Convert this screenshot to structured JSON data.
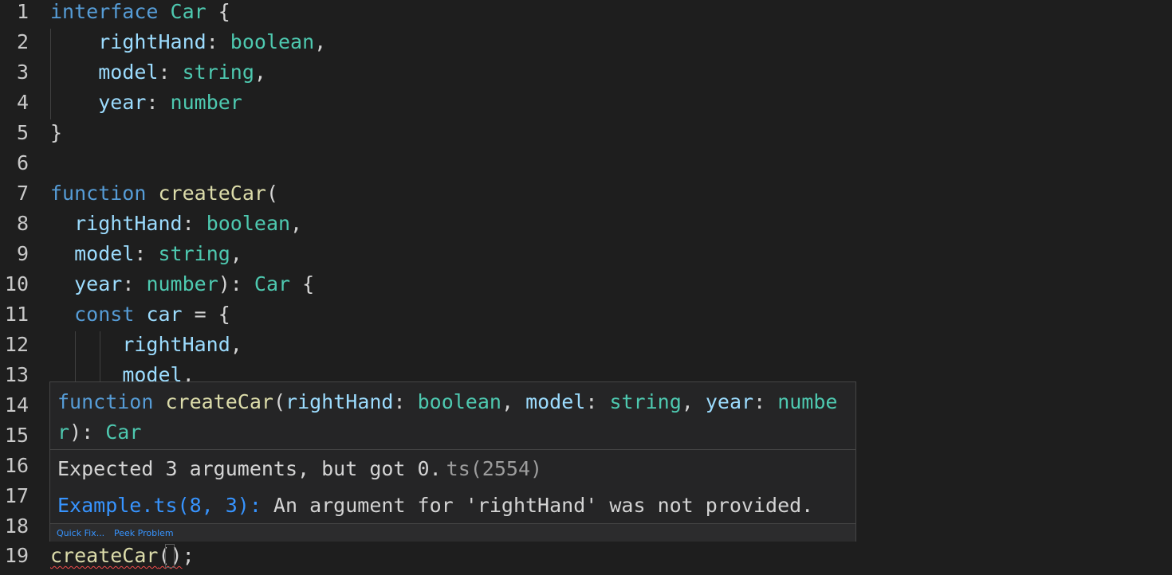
{
  "editor": {
    "lines": [
      {
        "num": "1",
        "tokens": [
          [
            "kw",
            "interface"
          ],
          [
            "pu",
            " "
          ],
          [
            "ty",
            "Car"
          ],
          [
            "pu",
            " {"
          ]
        ]
      },
      {
        "num": "2",
        "tokens": [
          [
            "pu",
            "    "
          ],
          [
            "pr",
            "rightHand"
          ],
          [
            "pu",
            ": "
          ],
          [
            "ty",
            "boolean"
          ],
          [
            "pu",
            ","
          ]
        ]
      },
      {
        "num": "3",
        "tokens": [
          [
            "pu",
            "    "
          ],
          [
            "pr",
            "model"
          ],
          [
            "pu",
            ": "
          ],
          [
            "ty",
            "string"
          ],
          [
            "pu",
            ","
          ]
        ]
      },
      {
        "num": "4",
        "tokens": [
          [
            "pu",
            "    "
          ],
          [
            "pr",
            "year"
          ],
          [
            "pu",
            ": "
          ],
          [
            "ty",
            "number"
          ]
        ]
      },
      {
        "num": "5",
        "tokens": [
          [
            "pu",
            "}"
          ]
        ]
      },
      {
        "num": "6",
        "tokens": []
      },
      {
        "num": "7",
        "tokens": [
          [
            "kw",
            "function"
          ],
          [
            "pu",
            " "
          ],
          [
            "fn",
            "createCar"
          ],
          [
            "pu",
            "("
          ]
        ]
      },
      {
        "num": "8",
        "tokens": [
          [
            "pu",
            "  "
          ],
          [
            "pr",
            "rightHand"
          ],
          [
            "pu",
            ": "
          ],
          [
            "ty",
            "boolean"
          ],
          [
            "pu",
            ","
          ]
        ]
      },
      {
        "num": "9",
        "tokens": [
          [
            "pu",
            "  "
          ],
          [
            "pr",
            "model"
          ],
          [
            "pu",
            ": "
          ],
          [
            "ty",
            "string"
          ],
          [
            "pu",
            ","
          ]
        ]
      },
      {
        "num": "10",
        "tokens": [
          [
            "pu",
            "  "
          ],
          [
            "pr",
            "year"
          ],
          [
            "pu",
            ": "
          ],
          [
            "ty",
            "number"
          ],
          [
            "pu",
            "): "
          ],
          [
            "ty",
            "Car"
          ],
          [
            "pu",
            " {"
          ]
        ]
      },
      {
        "num": "11",
        "tokens": [
          [
            "pu",
            "  "
          ],
          [
            "kw",
            "const"
          ],
          [
            "pu",
            " "
          ],
          [
            "pr",
            "car"
          ],
          [
            "pu",
            " = {"
          ]
        ]
      },
      {
        "num": "12",
        "tokens": [
          [
            "pu",
            "      "
          ],
          [
            "pr",
            "rightHand"
          ],
          [
            "pu",
            ","
          ]
        ]
      },
      {
        "num": "13",
        "tokens": [
          [
            "pu",
            "      "
          ],
          [
            "pr",
            "model"
          ],
          [
            "pu",
            ","
          ]
        ]
      },
      {
        "num": "14",
        "tokens": []
      },
      {
        "num": "15",
        "tokens": []
      },
      {
        "num": "16",
        "tokens": []
      },
      {
        "num": "17",
        "tokens": []
      },
      {
        "num": "18",
        "tokens": []
      },
      {
        "num": "19",
        "tokens": []
      }
    ],
    "line19": {
      "fn": "createCar",
      "parens": "()",
      "semi": ";"
    }
  },
  "hover": {
    "signature": [
      [
        "kw",
        "function"
      ],
      [
        "pu",
        " "
      ],
      [
        "fn",
        "createCar"
      ],
      [
        "pu",
        "("
      ],
      [
        "pr",
        "rightHand"
      ],
      [
        "pu",
        ": "
      ],
      [
        "ty",
        "boolean"
      ],
      [
        "pu",
        ", "
      ],
      [
        "pr",
        "model"
      ],
      [
        "pu",
        ": "
      ],
      [
        "ty",
        "string"
      ],
      [
        "pu",
        ", "
      ],
      [
        "pr",
        "year"
      ],
      [
        "pu",
        ": "
      ],
      [
        "ty",
        "number"
      ],
      [
        "pu",
        "): "
      ],
      [
        "ty",
        "Car"
      ]
    ],
    "message": "Expected 3 arguments, but got 0.",
    "code": "ts(2554)",
    "related_location": "Example.ts(8, 3):",
    "related_message": " An argument for 'rightHand' was not provided.",
    "actions": {
      "quick_fix": "Quick Fix...",
      "peek_problem": "Peek Problem"
    }
  },
  "colors": {
    "keyword": "#569cd6",
    "type": "#4ec9b0",
    "property": "#9cdcfe",
    "function": "#dcdcaa",
    "error": "#f14c4c",
    "link": "#3794ff"
  }
}
